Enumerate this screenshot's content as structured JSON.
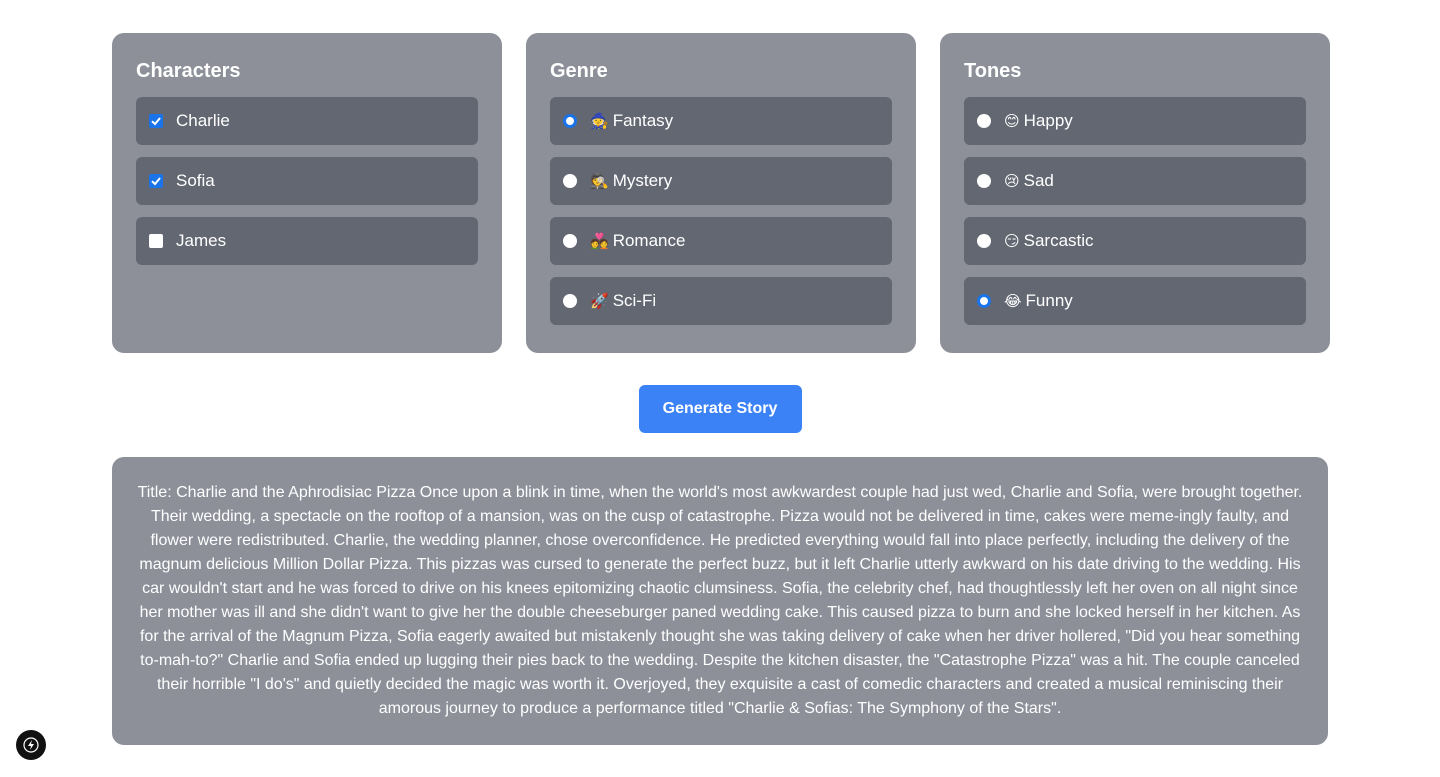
{
  "characters": {
    "title": "Characters",
    "items": [
      {
        "label": "Charlie",
        "checked": true
      },
      {
        "label": "Sofia",
        "checked": true
      },
      {
        "label": "James",
        "checked": false
      }
    ]
  },
  "genre": {
    "title": "Genre",
    "items": [
      {
        "emoji": "🧙",
        "label": "Fantasy",
        "selected": true
      },
      {
        "emoji": "🕵️",
        "label": "Mystery",
        "selected": false
      },
      {
        "emoji": "💑",
        "label": "Romance",
        "selected": false
      },
      {
        "emoji": "🚀",
        "label": "Sci-Fi",
        "selected": false
      }
    ]
  },
  "tones": {
    "title": "Tones",
    "items": [
      {
        "emoji": "😊",
        "label": "Happy",
        "selected": false
      },
      {
        "emoji": "😢",
        "label": "Sad",
        "selected": false
      },
      {
        "emoji": "😏",
        "label": "Sarcastic",
        "selected": false
      },
      {
        "emoji": "😂",
        "label": "Funny",
        "selected": true
      }
    ]
  },
  "generate_label": "Generate Story",
  "story_text": "Title: Charlie and the Aphrodisiac Pizza Once upon a blink in time, when the world's most awkwardest couple had just wed, Charlie and Sofia, were brought together. Their wedding, a spectacle on the rooftop of a mansion, was on the cusp of catastrophe. Pizza would not be delivered in time, cakes were meme-ingly faulty, and flower were redistributed. Charlie, the wedding planner, chose overconfidence. He predicted everything would fall into place perfectly, including the delivery of the magnum delicious Million Dollar Pizza. This pizzas was cursed to generate the perfect buzz, but it left Charlie utterly awkward on his date driving to the wedding. His car wouldn't start and he was forced to drive on his knees epitomizing chaotic clumsiness. Sofia, the celebrity chef, had thoughtlessly left her oven on all night since her mother was ill and she didn't want to give her the double cheeseburger paned wedding cake. This caused pizza to burn and she locked herself in her kitchen. As for the arrival of the Magnum Pizza, Sofia eagerly awaited but mistakenly thought she was taking delivery of cake when her driver hollered, \"Did you hear something to-mah-to?\" Charlie and Sofia ended up lugging their pies back to the wedding. Despite the kitchen disaster, the \"Catastrophe Pizza\" was a hit. The couple canceled their horrible \"I do's\" and quietly decided the magic was worth it. Overjoyed, they exquisite a cast of comedic characters and created a musical reminiscing their amorous journey to produce a performance titled \"Charlie & Sofias: The Symphony of the Stars\".",
  "colors": {
    "panel_bg": "#8d9099",
    "option_bg": "#636772",
    "accent": "#3b82f6",
    "check_blue": "#1a73e8"
  },
  "icons": {
    "fab": "lightning-bolt-icon"
  }
}
